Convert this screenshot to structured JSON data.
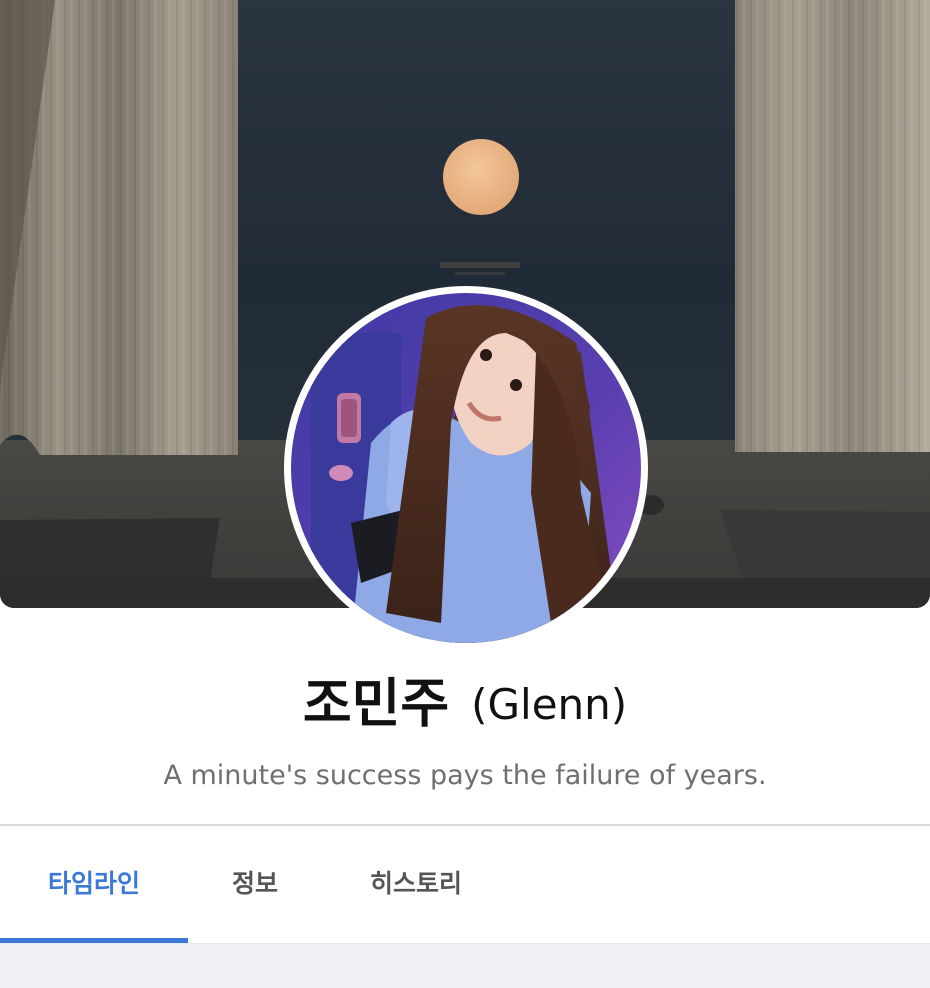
{
  "profile": {
    "name": "조민주",
    "english_name": "(Glenn)",
    "status_message": "A minute's success pays the failure of years."
  },
  "tabs": [
    {
      "label": "타임라인",
      "active": true
    },
    {
      "label": "정보",
      "active": false
    },
    {
      "label": "히스토리",
      "active": false
    }
  ],
  "colors": {
    "accent": "#3b78d8",
    "tab_inactive": "#555555",
    "status_text": "#6f6f6f",
    "content_background": "#eff1f4"
  },
  "cover_photo": {
    "icon": "night-sea-moon-curtains-photo"
  },
  "avatar": {
    "icon": "profile-photo"
  }
}
